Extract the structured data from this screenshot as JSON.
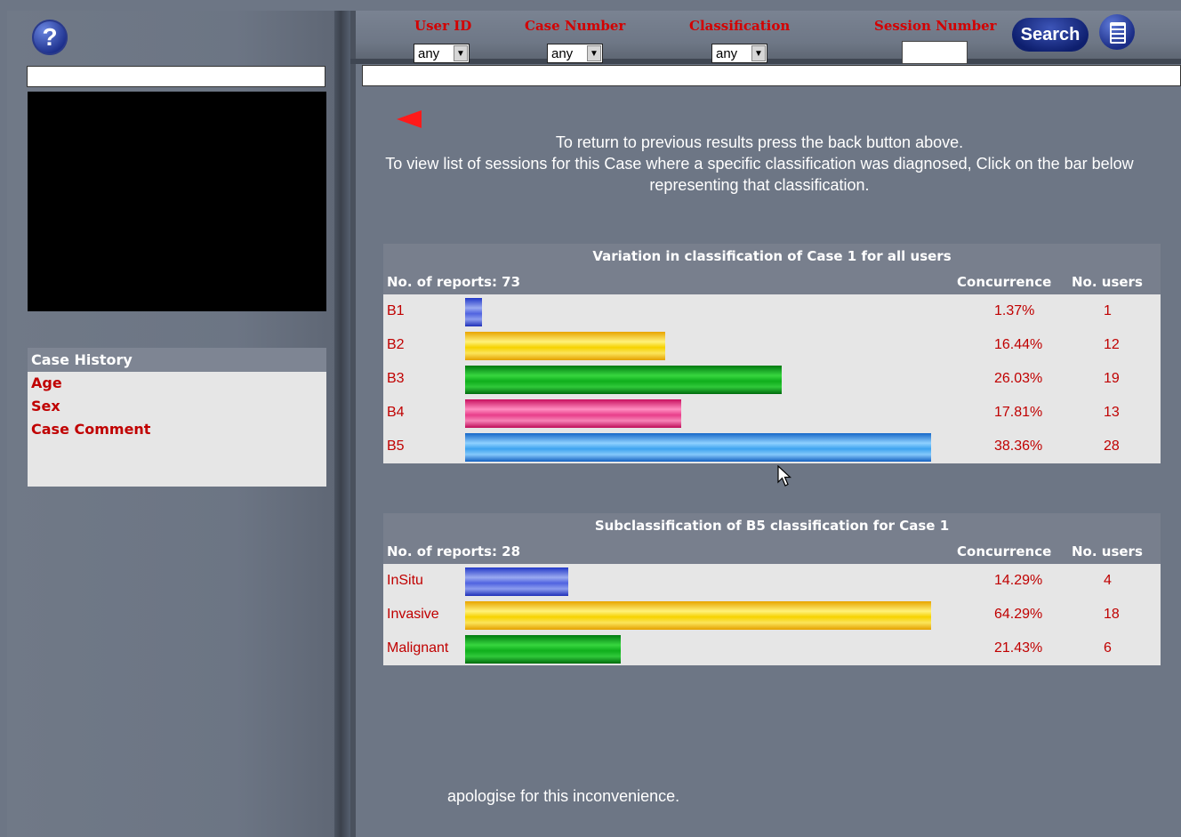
{
  "left": {
    "help_icon": "?",
    "case_history": {
      "title": "Case History",
      "fields": [
        "Age",
        "Sex",
        "Case Comment"
      ]
    }
  },
  "filters": {
    "user_id_label": "User ID",
    "user_id_value": "any",
    "case_number_label": "Case Number",
    "case_number_value": "any",
    "classification_label": "Classification",
    "classification_value": "any",
    "session_number_label": "Session Number",
    "search_label": "Search"
  },
  "instructions": {
    "line1": "To return to previous results press the back button above.",
    "line2": "To view list of sessions for this Case where a specific classification was diagnosed, Click on the bar below representing that classification."
  },
  "chart_data": [
    {
      "type": "bar",
      "title": "Variation in classification of Case 1 for all users",
      "reports_label": "No. of reports: 73",
      "concurrence_header": "Concurrence",
      "users_header": "No. users",
      "categories": [
        "B1",
        "B2",
        "B3",
        "B4",
        "B5"
      ],
      "values": [
        1.37,
        16.44,
        26.03,
        17.81,
        38.36
      ],
      "value_labels": [
        "1.37%",
        "16.44%",
        "26.03%",
        "17.81%",
        "38.36%"
      ],
      "users": [
        "1",
        "12",
        "19",
        "13",
        "28"
      ],
      "colors": [
        "#3347d6",
        "#f5cc10",
        "#13a820",
        "#e6458e",
        "#3a9ce8"
      ]
    },
    {
      "type": "bar",
      "title": "Subclassification of B5 classification for Case 1",
      "reports_label": "No. of reports: 28",
      "concurrence_header": "Concurrence",
      "users_header": "No. users",
      "categories": [
        "InSitu",
        "Invasive",
        "Malignant"
      ],
      "values": [
        14.29,
        64.29,
        21.43
      ],
      "value_labels": [
        "14.29%",
        "64.29%",
        "21.43%"
      ],
      "users": [
        "4",
        "18",
        "6"
      ],
      "colors": [
        "#3347d6",
        "#f5cc10",
        "#13a820"
      ]
    }
  ],
  "footer_text": "apologise for this inconvenience."
}
